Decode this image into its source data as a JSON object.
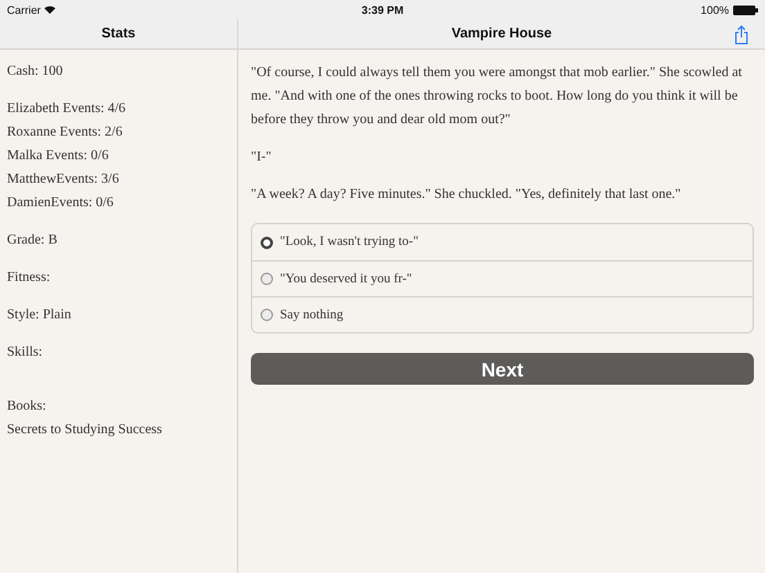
{
  "status_bar": {
    "carrier": "Carrier",
    "time": "3:39 PM",
    "battery": "100%"
  },
  "sidebar": {
    "title": "Stats",
    "sections": [
      [
        "Cash: 100"
      ],
      [
        "Elizabeth Events: 4/6",
        "Roxanne Events: 2/6",
        "Malka Events: 0/6",
        "MatthewEvents: 3/6",
        "DamienEvents: 0/6"
      ],
      [
        "Grade: B"
      ],
      [
        "Fitness:"
      ],
      [
        "Style: Plain"
      ],
      [
        "Skills:"
      ],
      [
        "Books:",
        "Secrets to Studying Success"
      ]
    ]
  },
  "main": {
    "title": "Vampire House",
    "paragraphs": [
      "\"Of course, I could always tell them you were amongst that mob earlier.\" She scowled at me. \"And with one of the ones throwing rocks to boot. How long do you think it will be before they throw you and dear old mom out?\"",
      "\"I-\"",
      "\"A week? A day? Five minutes.\" She chuckled. \"Yes, definitely that last one.\""
    ],
    "choices": [
      {
        "label": "\"Look, I wasn't trying to-\"",
        "selected": true
      },
      {
        "label": "\"You deserved it you fr-\"",
        "selected": false
      },
      {
        "label": "Say nothing",
        "selected": false
      }
    ],
    "next_button": "Next"
  }
}
